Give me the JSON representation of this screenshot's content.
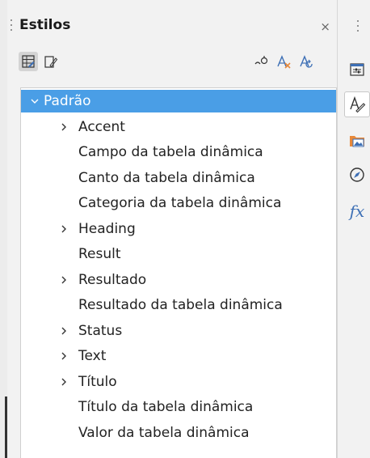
{
  "panel": {
    "title": "Estilos",
    "close_glyph": "×"
  },
  "toolbar": {
    "left_icons": [
      "paragraph-styles-icon",
      "character-styles-icon"
    ],
    "right_icons": [
      "fill-format-mode-icon",
      "new-style-from-selection-icon",
      "update-style-icon"
    ]
  },
  "tree": {
    "items": [
      {
        "label": "Padrão",
        "level": 0,
        "expandable": true,
        "expanded": true,
        "selected": true
      },
      {
        "label": "Accent",
        "level": 1,
        "expandable": true,
        "expanded": false,
        "selected": false
      },
      {
        "label": "Campo da tabela dinâmica",
        "level": 1,
        "expandable": false,
        "expanded": false,
        "selected": false
      },
      {
        "label": "Canto da tabela dinâmica",
        "level": 1,
        "expandable": false,
        "expanded": false,
        "selected": false
      },
      {
        "label": "Categoria da tabela dinâmica",
        "level": 1,
        "expandable": false,
        "expanded": false,
        "selected": false
      },
      {
        "label": "Heading",
        "level": 1,
        "expandable": true,
        "expanded": false,
        "selected": false
      },
      {
        "label": "Result",
        "level": 1,
        "expandable": false,
        "expanded": false,
        "selected": false
      },
      {
        "label": "Resultado",
        "level": 1,
        "expandable": true,
        "expanded": false,
        "selected": false
      },
      {
        "label": "Resultado da tabela dinâmica",
        "level": 1,
        "expandable": false,
        "expanded": false,
        "selected": false
      },
      {
        "label": "Status",
        "level": 1,
        "expandable": true,
        "expanded": false,
        "selected": false
      },
      {
        "label": "Text",
        "level": 1,
        "expandable": true,
        "expanded": false,
        "selected": false
      },
      {
        "label": "Título",
        "level": 1,
        "expandable": true,
        "expanded": false,
        "selected": false
      },
      {
        "label": "Título da tabela dinâmica",
        "level": 1,
        "expandable": false,
        "expanded": false,
        "selected": false
      },
      {
        "label": "Valor da tabela dinâmica",
        "level": 1,
        "expandable": false,
        "expanded": false,
        "selected": false
      }
    ]
  },
  "sidebar_tabs": {
    "icons": [
      "properties-icon",
      "styles-icon",
      "gallery-icon",
      "navigator-icon",
      "functions-icon"
    ],
    "active": "styles-icon",
    "functions_glyph": "fx"
  },
  "colors": {
    "selection": "#4a9ee6",
    "accent_blue": "#3d6fb5",
    "accent_orange": "#e8893a"
  }
}
